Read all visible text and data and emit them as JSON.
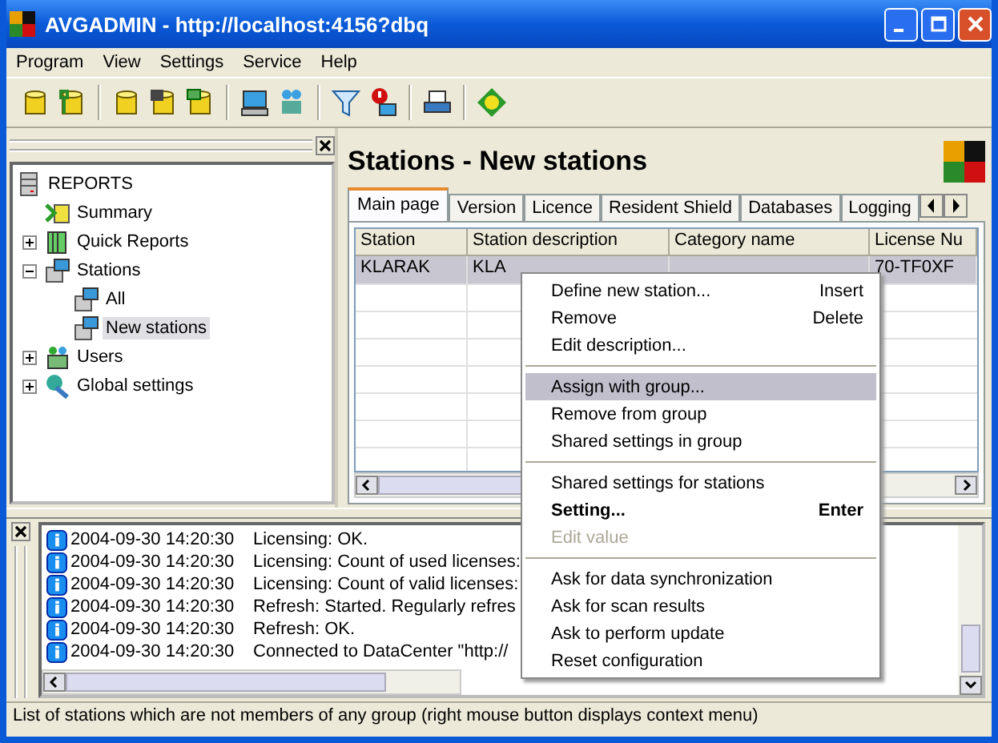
{
  "window": {
    "title": "AVGADMIN - http://localhost:4156?dbq"
  },
  "menu": [
    "Program",
    "View",
    "Settings",
    "Service",
    "Help"
  ],
  "tree": {
    "label": "REPORTS",
    "children": [
      {
        "label": "Summary"
      },
      {
        "label": "Quick Reports",
        "expanded": false
      },
      {
        "label": "Stations",
        "expanded": true,
        "children": [
          {
            "label": "All",
            "selected": false
          },
          {
            "label": "New stations",
            "selected": true
          }
        ]
      },
      {
        "label": "Users",
        "expanded": false
      },
      {
        "label": "Global settings",
        "expanded": false
      }
    ]
  },
  "page": {
    "title": "Stations - New stations"
  },
  "tabs": [
    {
      "label": "Main page",
      "selected": true
    },
    {
      "label": "Version",
      "selected": false
    },
    {
      "label": "Licence",
      "selected": false
    },
    {
      "label": "Resident Shield",
      "selected": false
    },
    {
      "label": "Databases",
      "selected": false
    },
    {
      "label": "Logging",
      "selected": false
    }
  ],
  "table": {
    "columns": [
      "Station",
      "Station description",
      "Category name",
      "License Nu"
    ],
    "rows": [
      {
        "cells": [
          "KLARAK",
          "KLA",
          "",
          "70-TF0XF"
        ],
        "selected": true
      }
    ]
  },
  "context_menu": [
    {
      "kind": "item",
      "label": "Define new station...",
      "shortcut": "Insert"
    },
    {
      "kind": "item",
      "label": "Remove",
      "shortcut": "Delete"
    },
    {
      "kind": "item",
      "label": "Edit description..."
    },
    {
      "kind": "separator"
    },
    {
      "kind": "item",
      "label": "Assign with group...",
      "selected": true
    },
    {
      "kind": "item",
      "label": "Remove from group"
    },
    {
      "kind": "item",
      "label": "Shared settings in group"
    },
    {
      "kind": "separator"
    },
    {
      "kind": "item",
      "label": "Shared settings for stations"
    },
    {
      "kind": "item",
      "label": "Setting...",
      "shortcut": "Enter",
      "bold": true
    },
    {
      "kind": "item",
      "label": "Edit value",
      "disabled": true
    },
    {
      "kind": "separator"
    },
    {
      "kind": "item",
      "label": "Ask for data synchronization"
    },
    {
      "kind": "item",
      "label": "Ask for scan results"
    },
    {
      "kind": "item",
      "label": "Ask to perform update"
    },
    {
      "kind": "item",
      "label": "Reset configuration"
    }
  ],
  "log": [
    {
      "time": "2004-09-30 14:20:30",
      "message": "Licensing: OK."
    },
    {
      "time": "2004-09-30 14:20:30",
      "message": "Licensing: Count of used licenses:"
    },
    {
      "time": "2004-09-30 14:20:30",
      "message": "Licensing: Count of valid licenses:"
    },
    {
      "time": "2004-09-30 14:20:30",
      "message": "Refresh: Started. Regularly refres"
    },
    {
      "time": "2004-09-30 14:20:30",
      "message": "Refresh: OK."
    },
    {
      "time": "2004-09-30 14:20:30",
      "message": "Connected to DataCenter \"http://"
    }
  ],
  "status_bar": "List of stations which are not members of any group (right mouse button displays context menu)"
}
